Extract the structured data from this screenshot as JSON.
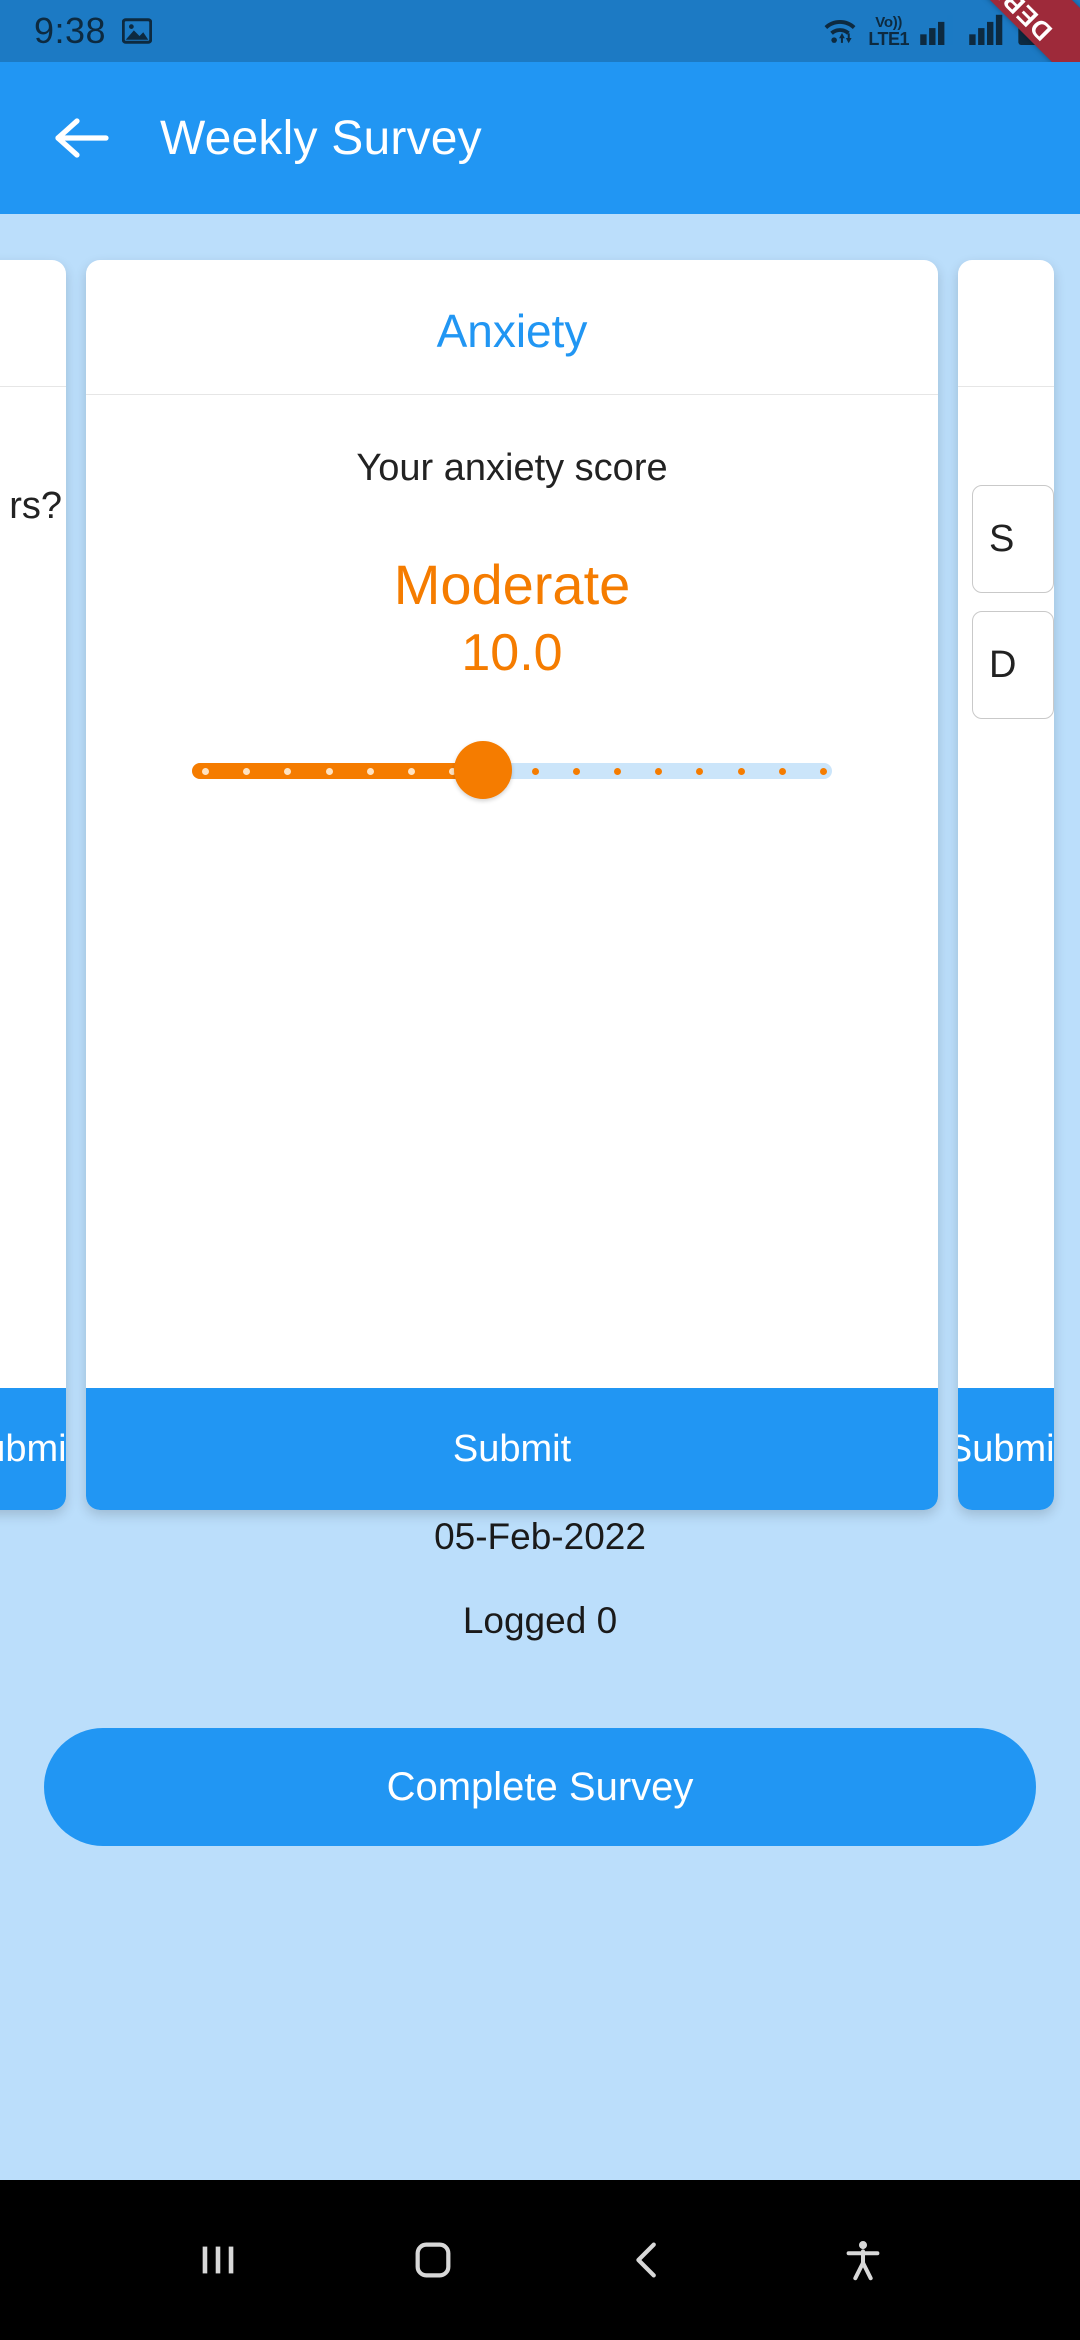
{
  "status_bar": {
    "time": "9:38",
    "image_icon": "image-icon",
    "wifi_icon": "wifi-icon",
    "volte_top": "Vo))",
    "volte_bottom": "LTE1",
    "signal_icon_1": "signal-bars-icon",
    "signal_icon_2": "signal-bars-icon",
    "battery_icon": "battery-icon",
    "debug_ribbon": "DEBUG",
    "bg_color": "#1C7AC4"
  },
  "app_bar": {
    "back_icon": "arrow-left-icon",
    "title": "Weekly Survey",
    "bg_color": "#2196F3"
  },
  "theme": {
    "background": "#BBDEFB",
    "primary": "#2196F3",
    "accent_orange": "#F57C00",
    "card_bg": "#FFFFFF"
  },
  "carousel": {
    "left_peek": {
      "title": "",
      "question_fragment": "rs?",
      "submit_label": "Submit"
    },
    "center_card": {
      "title": "Anxiety",
      "score_label": "Your anxiety score",
      "severity": "Moderate",
      "score_value": "10.0",
      "submit_label": "Submit",
      "slider": {
        "value": 10,
        "min": 0,
        "max": 21,
        "fill_color": "#F57C00",
        "track_color": "#CBE5FA",
        "tick_count": 16
      }
    },
    "right_peek": {
      "option_1": "S",
      "option_2": "D",
      "submit_label": "Submit"
    }
  },
  "meta": {
    "date": "05-Feb-2022",
    "logged": "Logged 0"
  },
  "complete_button": {
    "label": "Complete Survey"
  },
  "nav_bar": {
    "recents_icon": "recents-icon",
    "home_icon": "home-icon",
    "back_icon": "chevron-left-icon",
    "accessibility_icon": "accessibility-icon"
  }
}
